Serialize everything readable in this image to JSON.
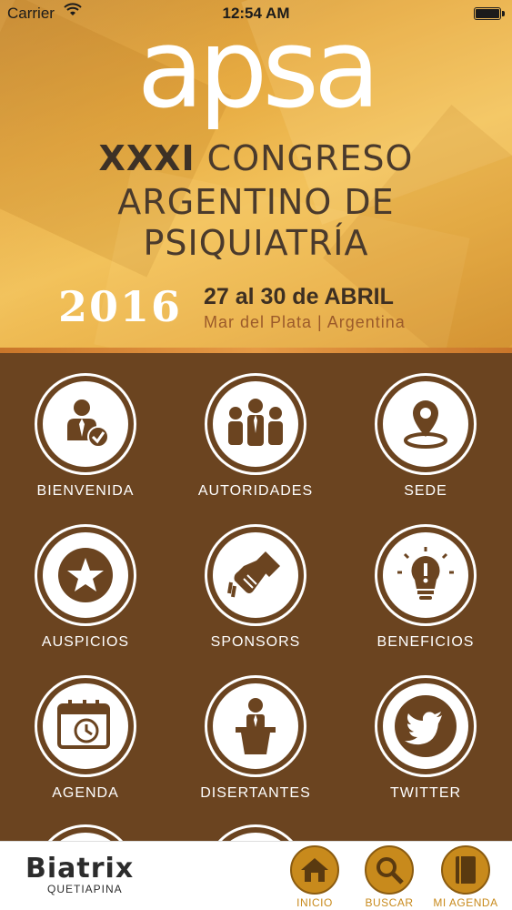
{
  "status_bar": {
    "carrier": "Carrier",
    "time": "12:54 AM"
  },
  "banner": {
    "logo": "apsa",
    "title_line1_bold": "XXXI",
    "title_line1_rest": " CONGRESO",
    "title_line2": "ARGENTINO DE",
    "title_line3": "PSIQUIATRÍA",
    "year": "2016",
    "dates": "27 al 30 de ABRIL",
    "place": "Mar del Plata | Argentina"
  },
  "menu": [
    {
      "label": "BIENVENIDA",
      "icon": "person-check-icon"
    },
    {
      "label": "AUTORIDADES",
      "icon": "group-icon"
    },
    {
      "label": "SEDE",
      "icon": "location-pin-icon"
    },
    {
      "label": "AUSPICIOS",
      "icon": "star-icon"
    },
    {
      "label": "SPONSORS",
      "icon": "handshake-icon"
    },
    {
      "label": "BENEFICIOS",
      "icon": "lightbulb-icon"
    },
    {
      "label": "AGENDA",
      "icon": "calendar-clock-icon"
    },
    {
      "label": "DISERTANTES",
      "icon": "speaker-podium-icon"
    },
    {
      "label": "TWITTER",
      "icon": "twitter-bird-icon"
    }
  ],
  "sponsor_brand": {
    "name": "Biatrix",
    "subtitle": "QUETIAPINA"
  },
  "tabs": [
    {
      "label": "INICIO",
      "icon": "home-icon"
    },
    {
      "label": "BUSCAR",
      "icon": "search-icon"
    },
    {
      "label": "MI AGENDA",
      "icon": "book-icon"
    }
  ],
  "colors": {
    "background": "#6b4420",
    "accent": "#c88a1c",
    "banner": "#e6a93f"
  }
}
